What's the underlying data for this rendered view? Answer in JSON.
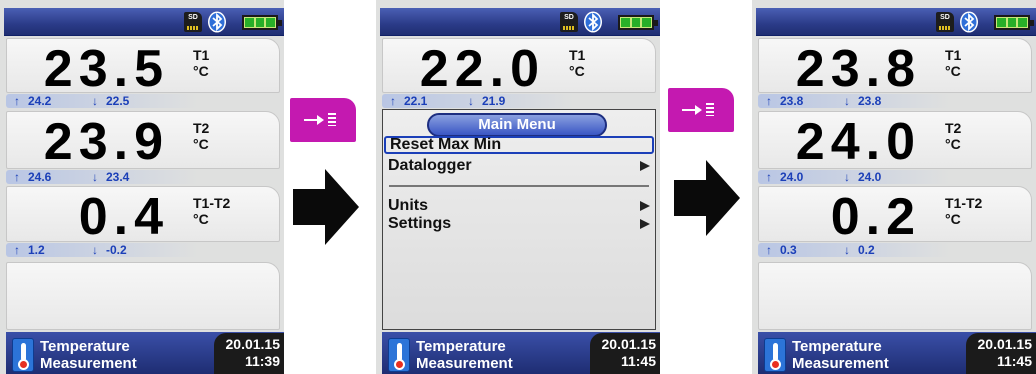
{
  "screens": [
    {
      "status": {
        "sd_label": "SD"
      },
      "channels": [
        {
          "value": "23.5",
          "label": "T1",
          "unit": "°C",
          "max": "24.2",
          "min": "22.5"
        },
        {
          "value": "23.9",
          "label": "T2",
          "unit": "°C",
          "max": "24.6",
          "min": "23.4"
        },
        {
          "value": "0.4",
          "label": "T1-T2",
          "unit": "°C",
          "max": "1.2",
          "min": "-0.2"
        }
      ],
      "footer": {
        "mode_line1": "Temperature",
        "mode_line2": "Measurement",
        "date": "20.01.15",
        "time": "11:39"
      }
    },
    {
      "status": {
        "sd_label": "SD"
      },
      "channels": [
        {
          "value": "22.0",
          "label": "T1",
          "unit": "°C",
          "max": "22.1",
          "min": "21.9"
        }
      ],
      "menu": {
        "title": "Main Menu",
        "items": [
          "Reset Max Min",
          "Datalogger",
          "Units",
          "Settings"
        ],
        "selected": "Reset Max Min"
      },
      "footer": {
        "mode_line1": "Temperature",
        "mode_line2": "Measurement",
        "date": "20.01.15",
        "time": "11:45"
      }
    },
    {
      "status": {
        "sd_label": "SD"
      },
      "channels": [
        {
          "value": "23.8",
          "label": "T1",
          "unit": "°C",
          "max": "23.8",
          "min": "23.8"
        },
        {
          "value": "24.0",
          "label": "T2",
          "unit": "°C",
          "max": "24.0",
          "min": "24.0"
        },
        {
          "value": "0.2",
          "label": "T1-T2",
          "unit": "°C",
          "max": "0.3",
          "min": "0.2"
        }
      ],
      "footer": {
        "mode_line1": "Temperature",
        "mode_line2": "Measurement",
        "date": "20.01.15",
        "time": "11:45"
      }
    }
  ],
  "softkeys": [
    {
      "icon": "store-arrow-icon",
      "color": "#c419b0"
    },
    {
      "icon": "store-arrow-icon",
      "color": "#c419b0"
    }
  ],
  "flow_arrows": [
    "right-arrow-icon",
    "right-arrow-icon"
  ],
  "colors": {
    "header_blue": "#2b3b88",
    "minmax_blue": "#1b3fb8",
    "softkey_magenta": "#c419b0",
    "panel_grey": "#dfe0df"
  }
}
